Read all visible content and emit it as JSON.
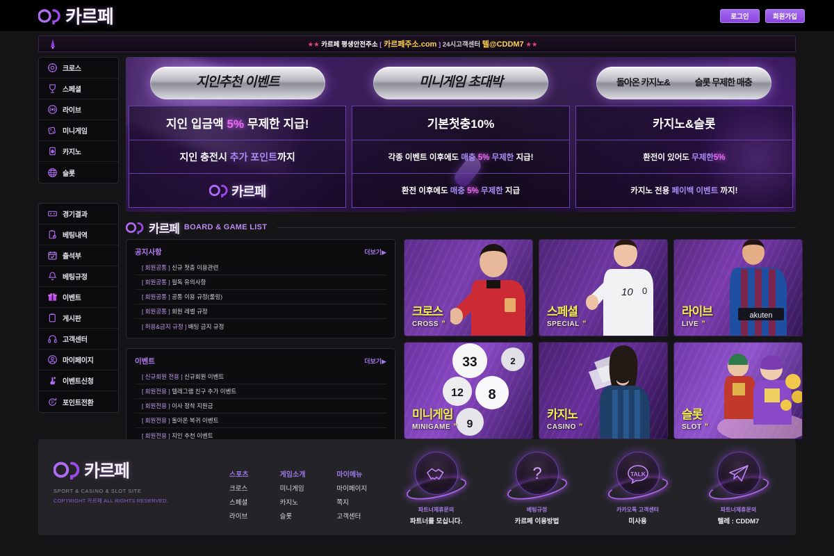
{
  "header": {
    "brand": "카르페",
    "login_label": "로그인",
    "signup_label": "회원가입"
  },
  "notice": {
    "stars_left": "★★",
    "prefix": "카르페 평생안전주소",
    "bracket_open": "[",
    "domain": "카르페주소.com",
    "bracket_close": "]",
    "center_label": "24시고객센터",
    "telegram": "텔@CDDM7",
    "stars_right": "★★"
  },
  "sidebar": {
    "group1": [
      {
        "label": "크로스",
        "icon": "target-icon"
      },
      {
        "label": "스페셜",
        "icon": "trophy-icon"
      },
      {
        "label": "라이브",
        "icon": "broadcast-icon"
      },
      {
        "label": "미니게임",
        "icon": "dice-icon"
      },
      {
        "label": "카지노",
        "icon": "cards-icon"
      },
      {
        "label": "슬롯",
        "icon": "globe-icon"
      }
    ],
    "group2": [
      {
        "label": "경기결과",
        "icon": "scoreboard-icon"
      },
      {
        "label": "베팅내역",
        "icon": "clipboard-check-icon"
      },
      {
        "label": "출석부",
        "icon": "calendar-check-icon"
      },
      {
        "label": "베팅규정",
        "icon": "bell-icon"
      },
      {
        "label": "이벤트",
        "icon": "gift-icon"
      },
      {
        "label": "게시판",
        "icon": "note-icon"
      },
      {
        "label": "고객센터",
        "icon": "headset-icon"
      },
      {
        "label": "마이페이지",
        "icon": "user-circle-icon"
      },
      {
        "label": "이벤트신청",
        "icon": "hand-star-icon"
      },
      {
        "label": "포인트전환",
        "icon": "point-refresh-icon"
      }
    ]
  },
  "banner": {
    "columns": [
      {
        "title": "지인추천 이벤트",
        "rows": [
          {
            "parts": [
              {
                "t": "지인 입금액 ",
                "c": "white"
              },
              {
                "t": "5%",
                "c": "pink"
              },
              {
                "t": " 무제한 지급!",
                "c": "white"
              }
            ],
            "size": "big"
          },
          {
            "parts": [
              {
                "t": "지인 충전시 ",
                "c": "white"
              },
              {
                "t": "추가 포인트",
                "c": "violet"
              },
              {
                "t": "까지",
                "c": "white"
              }
            ],
            "size": "mid"
          },
          {
            "logo": "카르페"
          }
        ]
      },
      {
        "title": "미니게임 초대박",
        "rows": [
          {
            "parts": [
              {
                "t": "기본첫충",
                "c": "white"
              },
              {
                "t": "10%",
                "c": "white"
              }
            ],
            "size": "big"
          },
          {
            "parts": [
              {
                "t": "각종 이벤트 이후에도 ",
                "c": "white"
              },
              {
                "t": "매충 ",
                "c": "violet"
              },
              {
                "t": "5%",
                "c": "pink"
              },
              {
                "t": " 무제한",
                "c": "violet"
              },
              {
                "t": " 지급!",
                "c": "white"
              }
            ],
            "size": "sm"
          },
          {
            "parts": [
              {
                "t": "환전 이후에도 ",
                "c": "white"
              },
              {
                "t": "매충 ",
                "c": "violet"
              },
              {
                "t": "5%",
                "c": "pink"
              },
              {
                "t": " 무제한",
                "c": "violet"
              },
              {
                "t": " 지급",
                "c": "white"
              }
            ],
            "size": "sm"
          }
        ]
      },
      {
        "title_l1": "돌아온 카지노&",
        "title_l2": "슬롯 무제한 매충",
        "rows": [
          {
            "parts": [
              {
                "t": "카지노&슬롯",
                "c": "white"
              }
            ],
            "size": "big"
          },
          {
            "parts": [
              {
                "t": "환전이 있어도 ",
                "c": "white"
              },
              {
                "t": "무제한",
                "c": "violet"
              },
              {
                "t": "5%",
                "c": "pink"
              }
            ],
            "size": "sm"
          },
          {
            "parts": [
              {
                "t": "카지노 전용 ",
                "c": "white"
              },
              {
                "t": "페이백 이벤트",
                "c": "violet"
              },
              {
                "t": " 까지!",
                "c": "white"
              }
            ],
            "size": "sm"
          }
        ]
      }
    ]
  },
  "section": {
    "brand": "카르페",
    "subtitle": "BOARD & GAME LIST"
  },
  "notice_box": {
    "title": "공지사항",
    "more": "더보기▶",
    "rows": [
      {
        "tag": "[ 회원공통 ]",
        "text": "신규 첫충 이용관련"
      },
      {
        "tag": "[ 회원공통 ]",
        "text": "필독 유의사항"
      },
      {
        "tag": "[ 회원공통 ]",
        "text": "공통 이용 규정(룰링)"
      },
      {
        "tag": "[ 회원공통 ]",
        "text": "회원 레벨 규정"
      },
      {
        "tag": "[ 허용&금지 규정 ]",
        "text": "배팅 금지 규정"
      }
    ]
  },
  "event_box": {
    "title": "이벤트",
    "more": "더보기▶",
    "rows": [
      {
        "tag": "[ 신규회원 전용 ]",
        "text": "신규회원 이벤트"
      },
      {
        "tag": "[ 회원전용 ]",
        "text": "텔레그램 친구 추가 이벤트"
      },
      {
        "tag": "[ 회원전용 ]",
        "text": "이사 정착 지원금"
      },
      {
        "tag": "[ 회원전용 ]",
        "text": "돌아온 복귀 이벤트"
      },
      {
        "tag": "[ 회원전용 ]",
        "text": "지인 추천 이벤트"
      }
    ]
  },
  "cards": [
    {
      "kr": "크로스",
      "en": "CROSS",
      "quote": "”",
      "cls": "c-cross",
      "fig": "soccer-player-red"
    },
    {
      "kr": "스페셜",
      "en": "SPECIAL",
      "quote": "”",
      "cls": "c-special",
      "fig": "soccer-player-white"
    },
    {
      "kr": "라이브",
      "en": "LIVE",
      "quote": "”",
      "cls": "c-live",
      "fig": "soccer-player-blue"
    },
    {
      "kr": "미니게임",
      "en": "MINIGAME",
      "quote": "”",
      "cls": "c-mini",
      "fig": "lottery-balls"
    },
    {
      "kr": "카지노",
      "en": "CASINO",
      "quote": "”",
      "cls": "c-casino",
      "fig": "casino-dealer"
    },
    {
      "kr": "슬롯",
      "en": "SLOT",
      "quote": "”",
      "cls": "c-slot",
      "fig": "slot-characters"
    }
  ],
  "footer": {
    "brand": "카르페",
    "tagline": "SPORT & CASINO & SLOT SITE",
    "copyright": "COPYRIGHT 카르페 ALL RIGHTS RESERVED.",
    "columns": [
      {
        "head": "스포츠",
        "links": [
          "크로스",
          "스페셜",
          "라이브"
        ]
      },
      {
        "head": "게임소개",
        "links": [
          "미니게임",
          "카지노",
          "슬롯"
        ]
      },
      {
        "head": "마이메뉴",
        "links": [
          "마이페이지",
          "쪽지",
          "고객센터"
        ]
      }
    ],
    "icons": [
      {
        "icon": "handshake-icon",
        "line1": "파트너제휴문의",
        "line2": "파트너를 모십니다."
      },
      {
        "icon": "question-icon",
        "line1": "베팅규정",
        "line2": "카르페 이용방법"
      },
      {
        "icon": "kakaotalk-icon",
        "line1": "카카오톡 고객센터",
        "line2": "미사용"
      },
      {
        "icon": "telegram-icon",
        "line1": "파트너제휴문의",
        "line2": "텔레 : CDDM7"
      }
    ]
  },
  "colors": {
    "accent": "#a56bf0",
    "page_bg": "#151517",
    "panel_bg": "#0d0d10",
    "card_yellow": "#f0eb52",
    "pink": "#e86bf0"
  }
}
